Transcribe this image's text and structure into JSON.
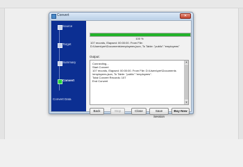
{
  "window": {
    "title": "Convert",
    "close_glyph": "✕"
  },
  "steps": [
    {
      "label": "Source",
      "active": false
    },
    {
      "label": "Target",
      "active": false
    },
    {
      "label": "Summary",
      "active": false
    },
    {
      "label": "Convert",
      "active": true
    }
  ],
  "sidebar_footer": "Convert Data",
  "progress": {
    "percent_text": "100 %",
    "fraction": 1.0,
    "fill_color": "#22b22a"
  },
  "summary_lines": [
    "107 records,   Elapsed: 00:00:00.    From File:",
    "D:\\Users\\per\\Documents\\employees.json,     To Table: \"public\".\"employees\""
  ],
  "output": {
    "label": "Output:",
    "lines": [
      "Connecting...",
      "Start Convert",
      "  107 records,   Elapsed: 00:00:00.    From File: D:\\Users\\per\\Documents",
      "  \\employees.json,    To Table: \"public\".\"employees\".",
      "Total Convert Records: 107",
      "End Convert"
    ]
  },
  "buttons": {
    "back": "Back",
    "stop": "Stop",
    "close": "Close",
    "save_session": "Save Session",
    "buy_now": "Buy Now"
  }
}
